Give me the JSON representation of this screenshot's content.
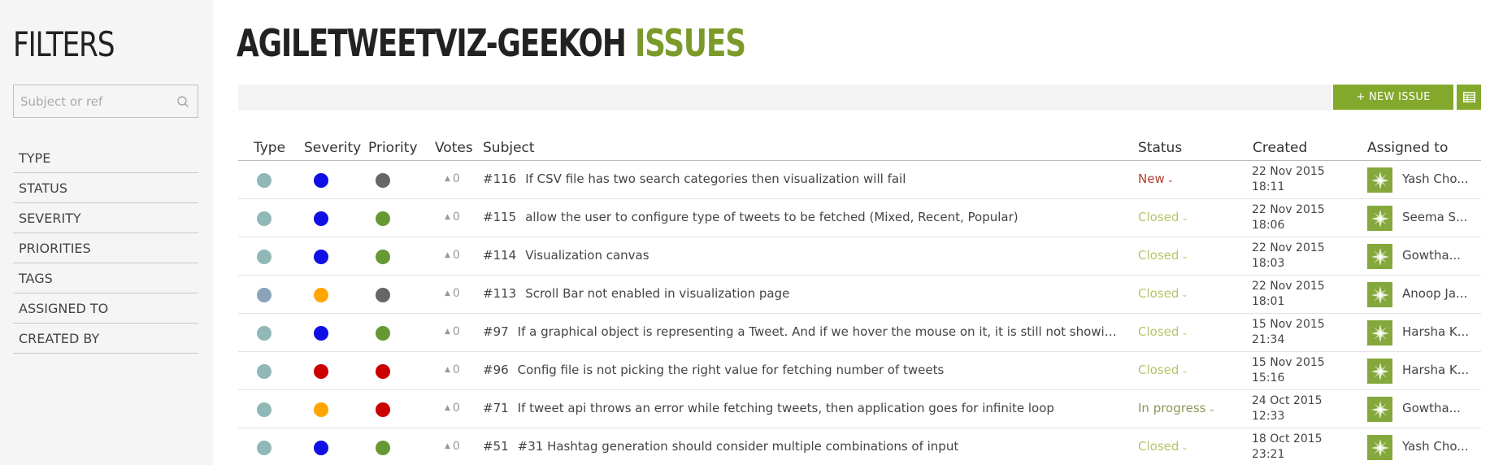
{
  "sidebar": {
    "title": "FILTERS",
    "search_placeholder": "Subject or ref",
    "filters": [
      "TYPE",
      "STATUS",
      "SEVERITY",
      "PRIORITIES",
      "TAGS",
      "ASSIGNED TO",
      "CREATED BY"
    ]
  },
  "header": {
    "project": "AGILETWEETVIZ-GEEKOH",
    "section": "ISSUES",
    "new_issue_label": "+ NEW ISSUE"
  },
  "table": {
    "columns": {
      "type": "Type",
      "severity": "Severity",
      "priority": "Priority",
      "votes": "Votes",
      "subject": "Subject",
      "status": "Status",
      "created": "Created",
      "assigned": "Assigned to"
    },
    "rows": [
      {
        "type_color": "#8fb8b6",
        "severity_color": "#0f0fe6",
        "priority_color": "#666666",
        "votes": "0",
        "ref": "#116",
        "subject": "If CSV file has two search categories then visualization will fail",
        "status": "New",
        "status_color": "#b0402e",
        "date": "22 Nov 2015",
        "time": "18:11",
        "assignee": "Yash Cho..."
      },
      {
        "type_color": "#8fb8b6",
        "severity_color": "#0f0fe6",
        "priority_color": "#669933",
        "votes": "0",
        "ref": "#115",
        "subject": "allow the user to configure type of tweets to be fetched (Mixed, Recent, Popular)",
        "status": "Closed",
        "status_color": "#b8c46a",
        "date": "22 Nov 2015",
        "time": "18:06",
        "assignee": "Seema S..."
      },
      {
        "type_color": "#8fb8b6",
        "severity_color": "#0f0fe6",
        "priority_color": "#669933",
        "votes": "0",
        "ref": "#114",
        "subject": "Visualization canvas",
        "status": "Closed",
        "status_color": "#b8c46a",
        "date": "22 Nov 2015",
        "time": "18:03",
        "assignee": "Gowtha..."
      },
      {
        "type_color": "#89a3ba",
        "severity_color": "#ffa500",
        "priority_color": "#666666",
        "votes": "0",
        "ref": "#113",
        "subject": "Scroll Bar not enabled in visualization page",
        "status": "Closed",
        "status_color": "#b8c46a",
        "date": "22 Nov 2015",
        "time": "18:01",
        "assignee": "Anoop Ja..."
      },
      {
        "type_color": "#8fb8b6",
        "severity_color": "#0f0fe6",
        "priority_color": "#669933",
        "votes": "0",
        "ref": "#97",
        "subject": "If a graphical object is representing a Tweet. And if we hover the mouse on it, it is still not showing Tweet M...",
        "status": "Closed",
        "status_color": "#b8c46a",
        "date": "15 Nov 2015",
        "time": "21:34",
        "assignee": "Harsha K..."
      },
      {
        "type_color": "#8fb8b6",
        "severity_color": "#cc0000",
        "priority_color": "#cc0000",
        "votes": "0",
        "ref": "#96",
        "subject": "Config file is not picking the right value for fetching number of tweets",
        "status": "Closed",
        "status_color": "#b8c46a",
        "date": "15 Nov 2015",
        "time": "15:16",
        "assignee": "Harsha K..."
      },
      {
        "type_color": "#8fb8b6",
        "severity_color": "#ffa500",
        "priority_color": "#cc0000",
        "votes": "0",
        "ref": "#71",
        "subject": "If tweet api throws an error while fetching tweets, then application goes for infinite loop",
        "status": "In progress",
        "status_color": "#8a9a5b",
        "date": "24 Oct 2015",
        "time": "12:33",
        "assignee": "Gowtha..."
      },
      {
        "type_color": "#8fb8b6",
        "severity_color": "#0f0fe6",
        "priority_color": "#669933",
        "votes": "0",
        "ref": "#51",
        "subject": "#31 Hashtag generation should consider multiple combinations of input",
        "status": "Closed",
        "status_color": "#b8c46a",
        "date": "18 Oct 2015",
        "time": "23:21",
        "assignee": "Yash Cho..."
      }
    ]
  },
  "colors": {
    "accent": "#83a92c",
    "sidebar_bg": "#f5f5f5"
  }
}
